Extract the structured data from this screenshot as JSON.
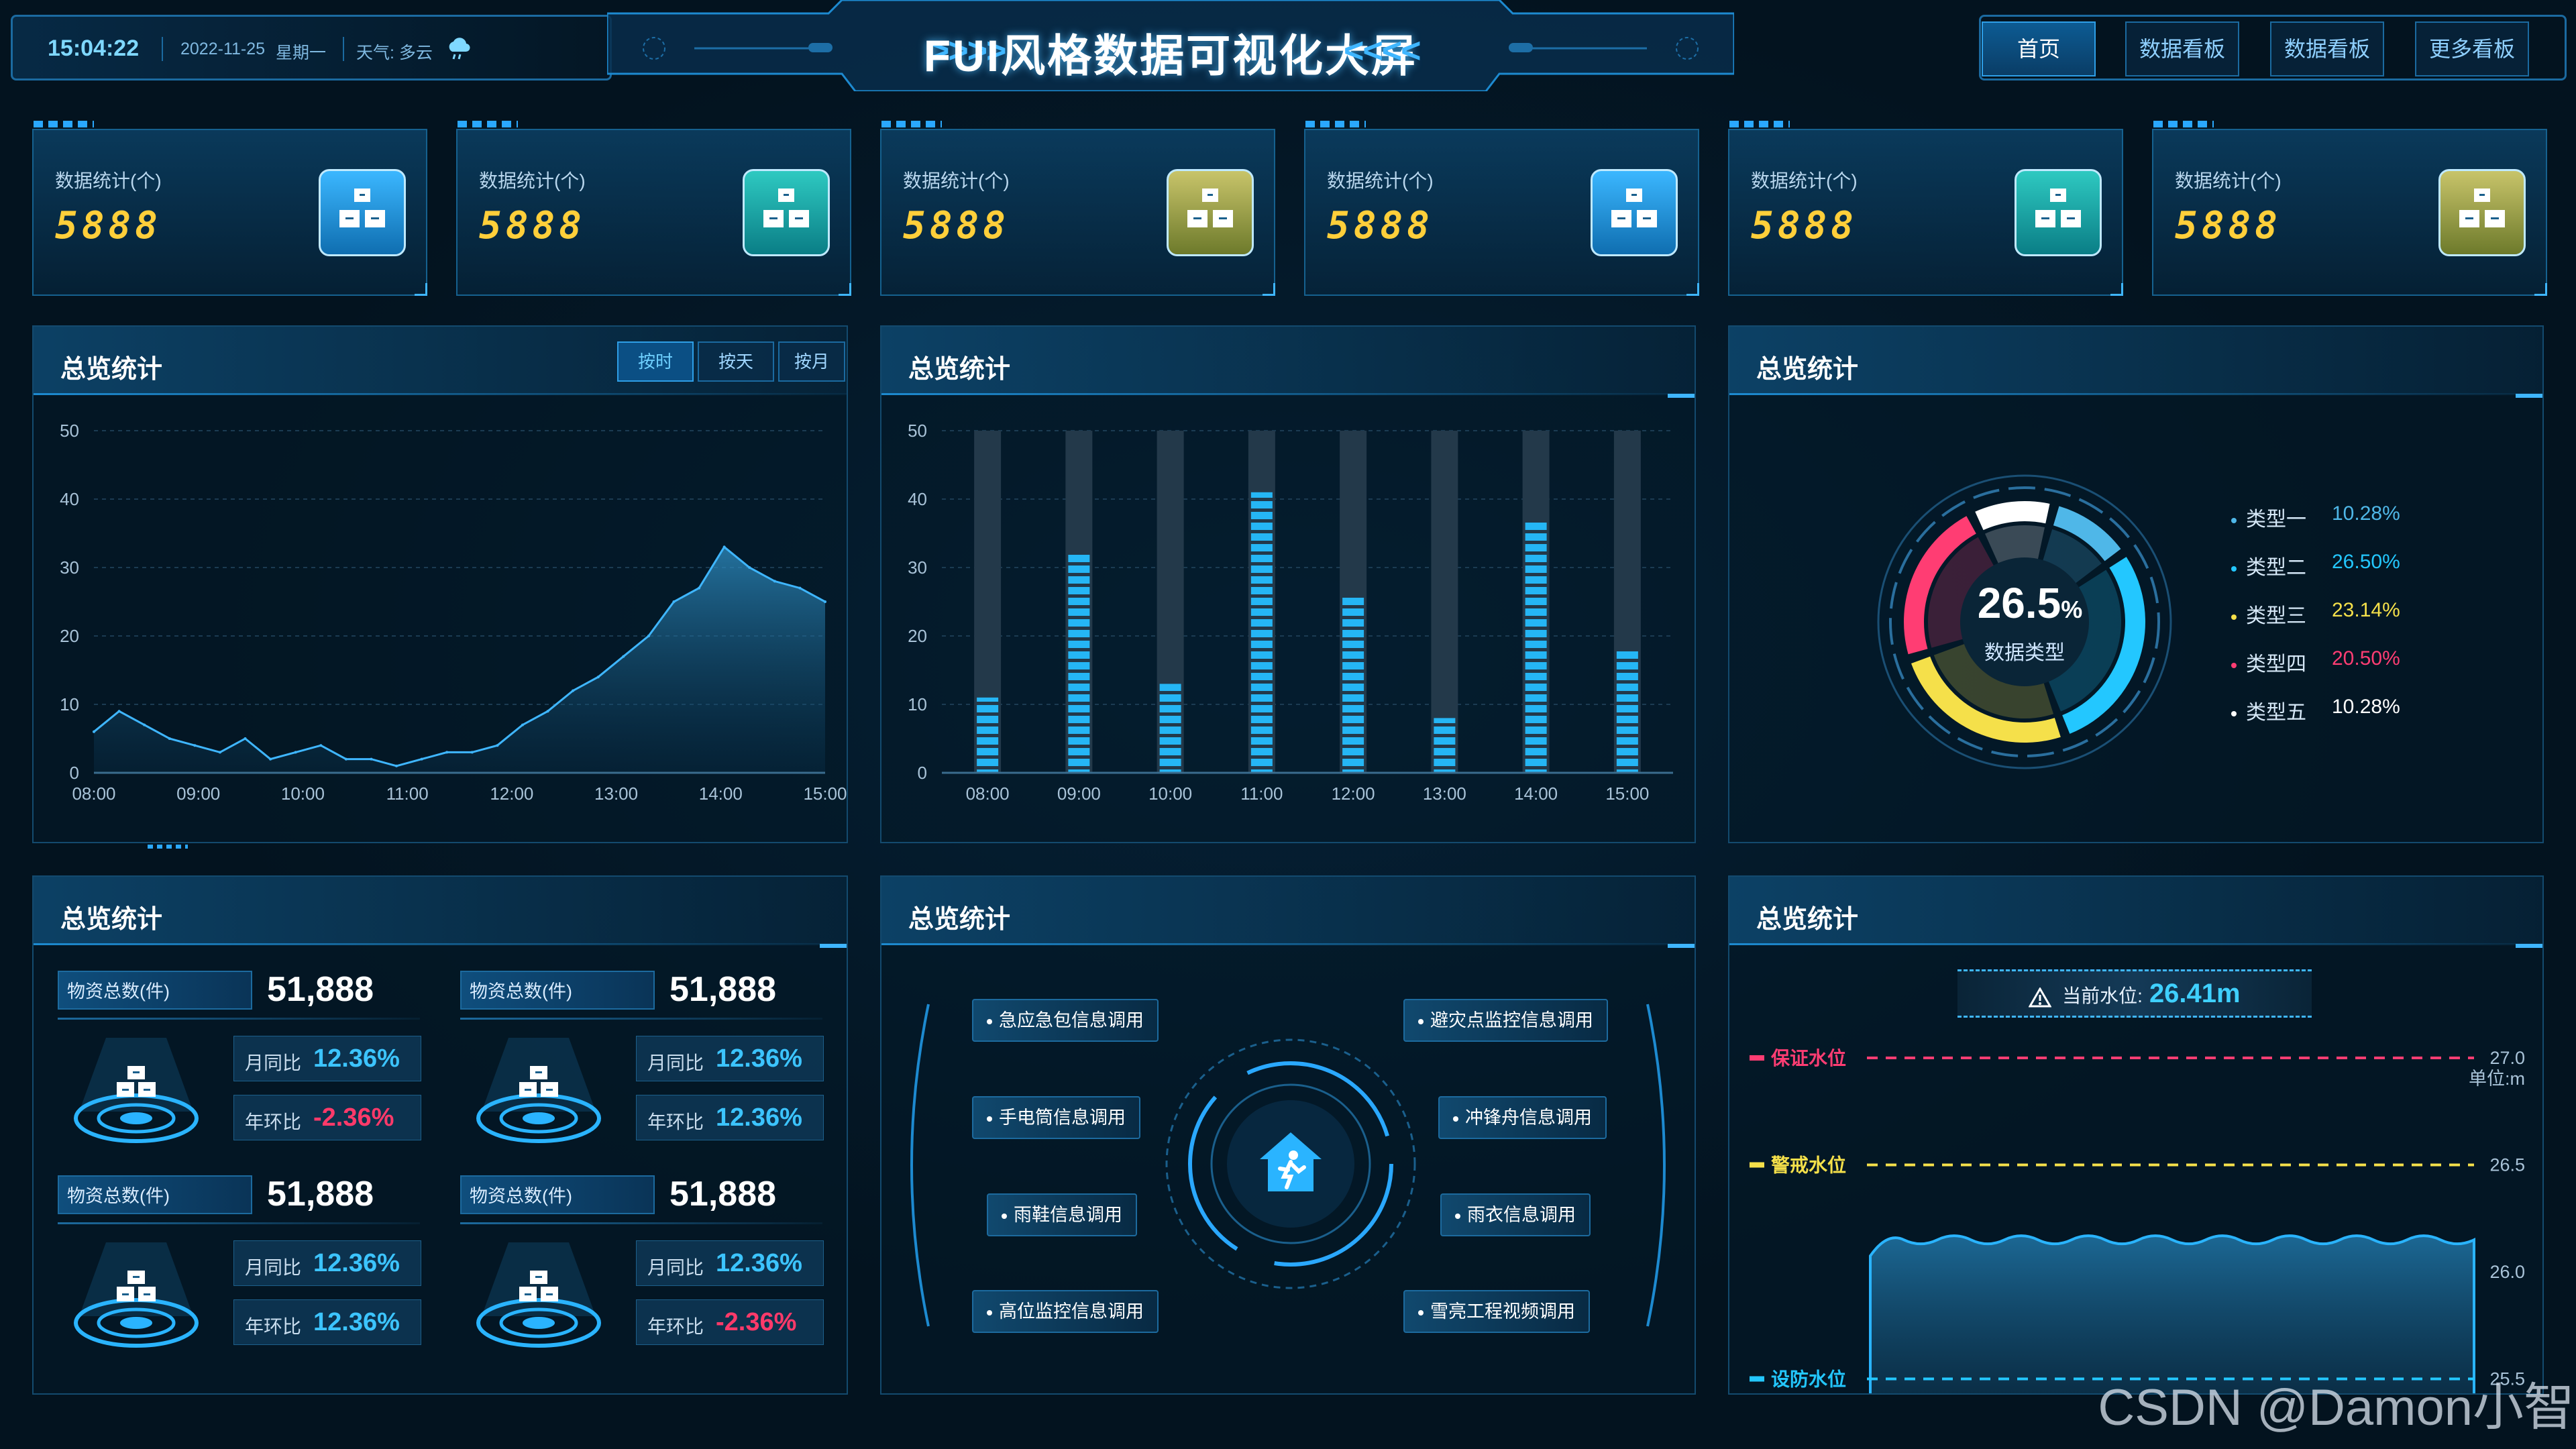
{
  "header": {
    "time": "15:04:22",
    "date": "2022-11-25",
    "weekday": "星期一",
    "weather_label": "天气:",
    "weather": "多云",
    "title": "FUI风格数据可视化大屏",
    "nav": [
      {
        "label": "首页",
        "active": true
      },
      {
        "label": "数据看板",
        "active": false
      },
      {
        "label": "数据看板",
        "active": false
      },
      {
        "label": "更多看板",
        "active": false
      }
    ]
  },
  "stat_cards": [
    {
      "label": "数据统计(个)",
      "value": "5888",
      "icon_color": "blue"
    },
    {
      "label": "数据统计(个)",
      "value": "5888",
      "icon_color": "teal"
    },
    {
      "label": "数据统计(个)",
      "value": "5888",
      "icon_color": "olive"
    },
    {
      "label": "数据统计(个)",
      "value": "5888",
      "icon_color": "blue"
    },
    {
      "label": "数据统计(个)",
      "value": "5888",
      "icon_color": "teal"
    },
    {
      "label": "数据统计(个)",
      "value": "5888",
      "icon_color": "olive"
    }
  ],
  "panels": {
    "area_title": "总览统计",
    "bar_title": "总览统计",
    "donut_title": "总览统计",
    "materials_title": "总览统计",
    "emergency_title": "总览统计",
    "water_title": "总览统计"
  },
  "area_toggle": {
    "by_hour": "按时",
    "by_day": "按天",
    "by_month": "按月",
    "selected": "按时"
  },
  "chart_data": [
    {
      "type": "area",
      "title": "总览统计",
      "x_ticks": [
        "08:00",
        "09:00",
        "10:00",
        "11:00",
        "12:00",
        "13:00",
        "14:00",
        "15:00"
      ],
      "ylim": [
        0,
        50
      ],
      "y_ticks": [
        0,
        10,
        20,
        30,
        40,
        50
      ],
      "x": [
        "08:00",
        "08:15",
        "08:30",
        "08:45",
        "09:00",
        "09:15",
        "09:30",
        "09:45",
        "10:00",
        "10:15",
        "10:30",
        "10:45",
        "11:00",
        "11:15",
        "11:30",
        "11:45",
        "12:00",
        "12:15",
        "12:30",
        "12:45",
        "13:00",
        "13:15",
        "13:30",
        "13:45",
        "14:00",
        "14:15",
        "14:30",
        "14:45",
        "15:00",
        "15:15"
      ],
      "y": [
        6,
        9,
        7,
        5,
        4,
        3,
        5,
        2,
        3,
        4,
        2,
        2,
        1,
        2,
        3,
        3,
        4,
        7,
        9,
        12,
        14,
        17,
        20,
        25,
        27,
        33,
        30,
        28,
        27,
        25
      ],
      "color": "#3fb6ff"
    },
    {
      "type": "bar",
      "title": "总览统计",
      "categories": [
        "08:00",
        "09:00",
        "10:00",
        "11:00",
        "12:00",
        "13:00",
        "14:00",
        "15:00"
      ],
      "values": [
        11,
        32,
        13,
        41,
        26,
        8,
        37,
        18
      ],
      "ylim": [
        0,
        50
      ],
      "y_ticks": [
        0,
        10,
        20,
        30,
        40,
        50
      ],
      "color": "#25b6f5"
    },
    {
      "type": "pie",
      "title": "总览统计",
      "center_value": "26.5",
      "center_unit": "%",
      "center_label": "数据类型",
      "slices": [
        {
          "name": "类型一",
          "value": 10.28,
          "label": "10.28%",
          "color": "#4fb7e8"
        },
        {
          "name": "类型二",
          "value": 26.5,
          "label": "26.50%",
          "color": "#23c7ff"
        },
        {
          "name": "类型三",
          "value": 23.14,
          "label": "23.14%",
          "color": "#f5e04a"
        },
        {
          "name": "类型四",
          "value": 20.5,
          "label": "20.50%",
          "color": "#ff3d73"
        },
        {
          "name": "类型五",
          "value": 10.28,
          "label": "10.28%",
          "color": "#ffffff"
        }
      ]
    },
    {
      "type": "area",
      "title": "总览统计",
      "unit": "单位:m",
      "ylim": [
        25.0,
        27.0
      ],
      "y_ticks": [
        25.0,
        25.5,
        26.0,
        26.5,
        27.0
      ],
      "current_level": 26.15,
      "levels": [
        {
          "name": "保证水位",
          "value": 27.0,
          "color": "#ff3d73"
        },
        {
          "name": "警戒水位",
          "value": 26.5,
          "color": "#f5e04a"
        },
        {
          "name": "设防水位",
          "value": 25.5,
          "color": "#23c7ff"
        }
      ]
    }
  ],
  "materials": [
    {
      "label": "物资总数(件)",
      "value": "51,888",
      "mom_label": "月同比",
      "mom": "12.36%",
      "mom_dir": "up",
      "yoy_label": "年环比",
      "yoy": "-2.36%",
      "yoy_dir": "down"
    },
    {
      "label": "物资总数(件)",
      "value": "51,888",
      "mom_label": "月同比",
      "mom": "12.36%",
      "mom_dir": "up",
      "yoy_label": "年环比",
      "yoy": "12.36%",
      "yoy_dir": "up"
    },
    {
      "label": "物资总数(件)",
      "value": "51,888",
      "mom_label": "月同比",
      "mom": "12.36%",
      "mom_dir": "up",
      "yoy_label": "年环比",
      "yoy": "12.36%",
      "yoy_dir": "up"
    },
    {
      "label": "物资总数(件)",
      "value": "51,888",
      "mom_label": "月同比",
      "mom": "12.36%",
      "mom_dir": "up",
      "yoy_label": "年环比",
      "yoy": "-2.36%",
      "yoy_dir": "down"
    }
  ],
  "emergency": {
    "left": [
      "急应急包信息调用",
      "手电筒信息调用",
      "雨鞋信息调用",
      "高位监控信息调用"
    ],
    "right": [
      "避灾点监控信息调用",
      "冲锋舟信息调用",
      "雨衣信息调用",
      "雪亮工程视频调用"
    ]
  },
  "water": {
    "current_label": "当前水位:",
    "current_value": "26.41m",
    "unit": "单位:m"
  },
  "watermark": "CSDN @Damon小智"
}
